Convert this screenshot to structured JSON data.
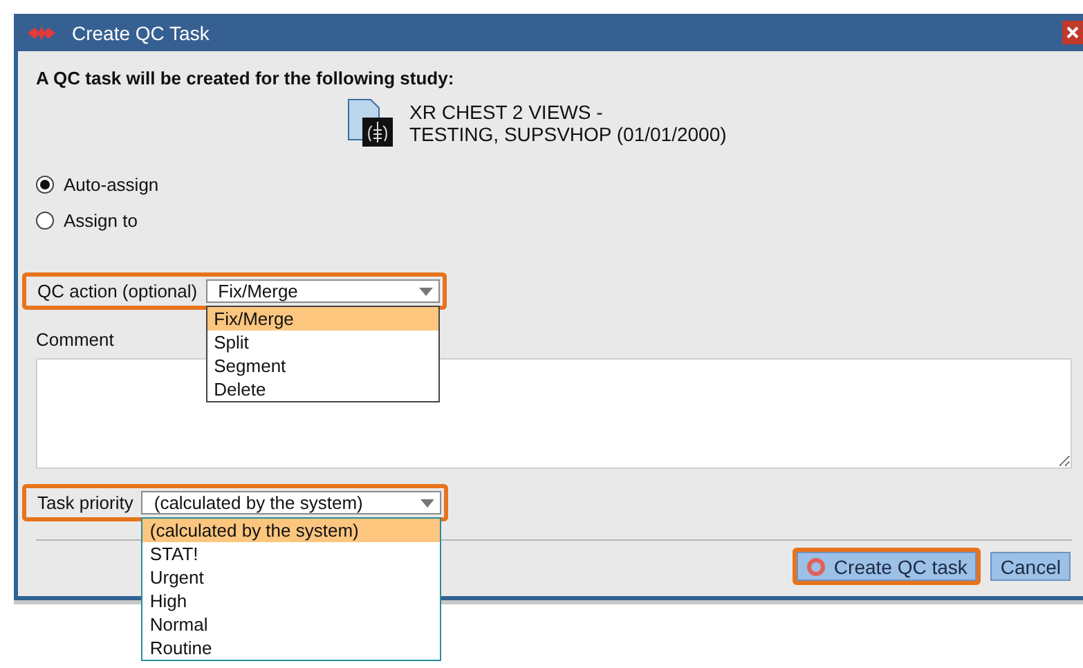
{
  "window": {
    "title": "Create QC Task"
  },
  "intro": "A QC task will be created for the following study:",
  "study": {
    "lines": [
      "XR CHEST 2 VIEWS -",
      "TESTING, SUPSVHOP (01/01/2000)"
    ]
  },
  "assignment": [
    {
      "label": "Auto-assign",
      "selected": true
    },
    {
      "label": "Assign to",
      "selected": false
    }
  ],
  "qc_action": {
    "label": "QC action (optional)",
    "value": "Fix/Merge",
    "highlighted": true,
    "expanded": true,
    "options": [
      {
        "label": "Fix/Merge",
        "selected": true
      },
      {
        "label": "Split",
        "selected": false
      },
      {
        "label": "Segment",
        "selected": false
      },
      {
        "label": "Delete",
        "selected": false
      }
    ]
  },
  "comment": {
    "label": "Comment"
  },
  "task_priority": {
    "label": "Task priority",
    "value": "(calculated by the system)",
    "highlighted": true,
    "expanded": true,
    "options": [
      {
        "label": "(calculated by the system)",
        "selected": true
      },
      {
        "label": "STAT!",
        "selected": false
      },
      {
        "label": "Urgent",
        "selected": false
      },
      {
        "label": "High",
        "selected": false
      },
      {
        "label": "Normal",
        "selected": false
      },
      {
        "label": "Routine",
        "selected": false
      }
    ]
  },
  "buttons": [
    {
      "label": "Create QC task",
      "kind": "primary",
      "highlighted": true
    },
    {
      "label": "Cancel",
      "kind": "secondary",
      "highlighted": false
    }
  ]
}
